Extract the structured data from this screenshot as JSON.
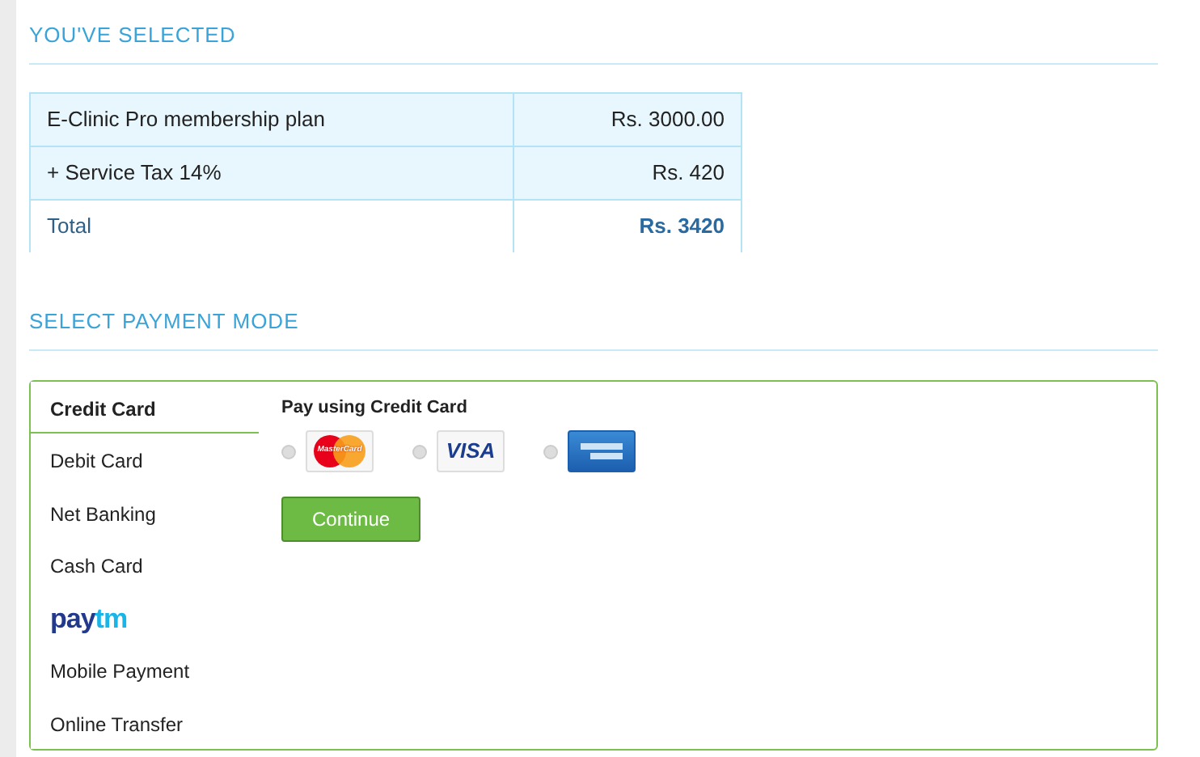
{
  "summary": {
    "heading": "YOU'VE SELECTED",
    "rows": [
      {
        "kind": "item",
        "label": "E-Clinic Pro membership plan",
        "amount": "Rs. 3000.00"
      },
      {
        "kind": "item",
        "label": "+ Service Tax 14%",
        "amount": "Rs. 420"
      },
      {
        "kind": "total",
        "label": "Total",
        "amount": "Rs. 3420"
      }
    ]
  },
  "payment": {
    "heading": "SELECT PAYMENT MODE",
    "modes": [
      {
        "kind": "text",
        "label": "Credit Card",
        "selected": true
      },
      {
        "kind": "text",
        "label": "Debit Card",
        "selected": false
      },
      {
        "kind": "text",
        "label": "Net Banking",
        "selected": false
      },
      {
        "kind": "text",
        "label": "Cash Card",
        "selected": false
      },
      {
        "kind": "logo",
        "label": "paytm",
        "selected": false
      },
      {
        "kind": "text",
        "label": "Mobile Payment",
        "selected": false
      },
      {
        "kind": "text",
        "label": "Online Transfer",
        "selected": false
      }
    ],
    "panel": {
      "title": "Pay using Credit Card",
      "cards": [
        {
          "kind": "mastercard",
          "label": "MasterCard",
          "selected": false
        },
        {
          "kind": "visa",
          "label": "VISA",
          "selected": false
        },
        {
          "kind": "amex",
          "selected": false
        }
      ],
      "button": "Continue"
    }
  }
}
